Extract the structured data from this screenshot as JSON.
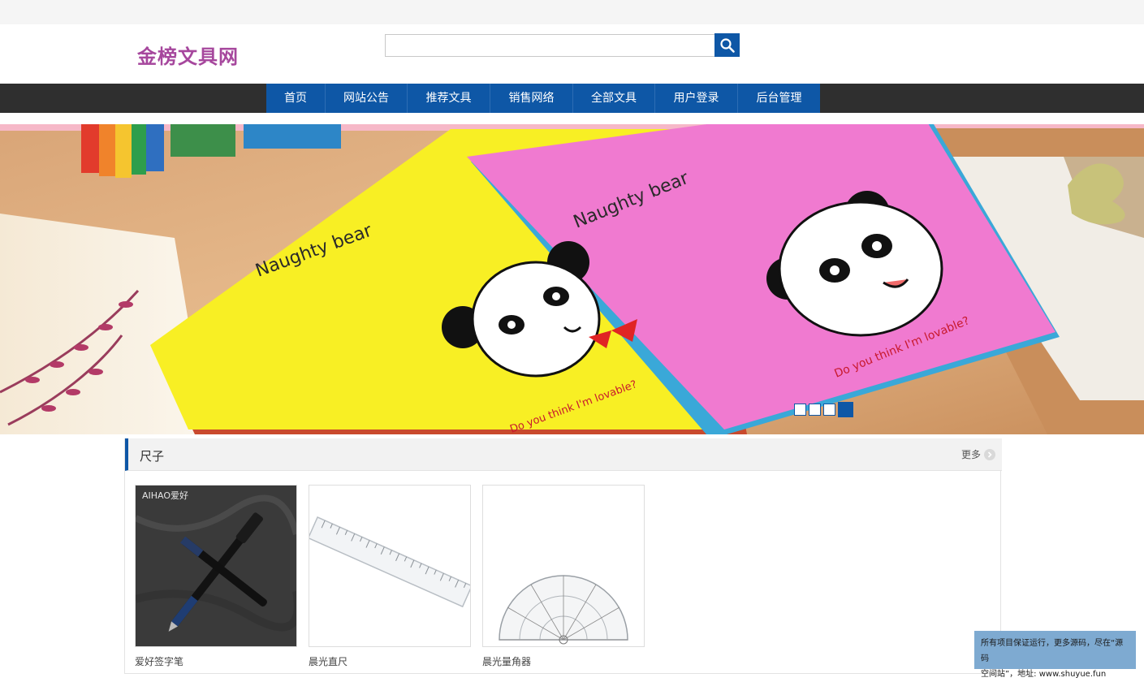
{
  "site": {
    "logo": "金榜文具网"
  },
  "search": {
    "placeholder": "",
    "value": ""
  },
  "nav": {
    "items": [
      "首页",
      "网站公告",
      "推荐文具",
      "销售网络",
      "全部文具",
      "用户登录",
      "后台管理"
    ]
  },
  "banner": {
    "notebook_title": "Naughty bear",
    "notebook_caption": "Do you think I'm lovable?",
    "slides": 4,
    "active_slide": 4
  },
  "section": {
    "title": "尺子",
    "more_label": "更多",
    "products": [
      {
        "name": "爱好签字笔",
        "brand": "AIHAO爱好"
      },
      {
        "name": "晨光直尺"
      },
      {
        "name": "晨光量角器"
      }
    ]
  },
  "notice": {
    "line1": "所有项目保证运行，更多源码，尽在“源码",
    "line2": "空间站”，地址: www.shuyue.fun"
  },
  "colors": {
    "brand_blue": "#0e57a6",
    "logo_purple": "#a6479d",
    "nav_dark": "#2f2f2f"
  }
}
